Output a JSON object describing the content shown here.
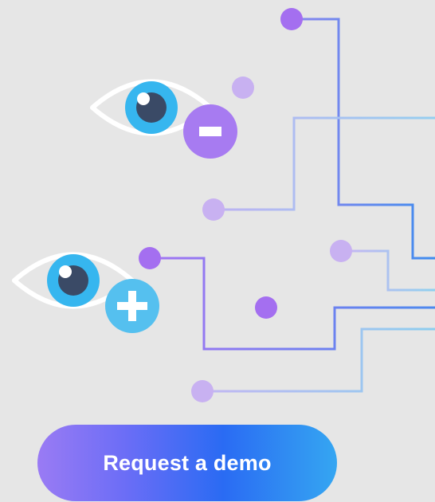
{
  "cta": {
    "label": "Request a demo"
  },
  "illustration": {
    "icons": [
      "eye-icon",
      "minus-badge-icon",
      "eye-icon",
      "plus-badge-icon"
    ],
    "colors": {
      "background": "#e6e6e6",
      "eye_iris": "#36b6ef",
      "eye_pupil": "#3a4a66",
      "eye_outline": "#ffffff",
      "minus_badge": "#a77bf1",
      "plus_badge": "#55c0ef",
      "node_purple": "#a46ff0",
      "node_lilac": "#c8b1f1",
      "line_blue": "#3a88ee",
      "line_sky": "#86ccef",
      "line_teal": "#7fd0dd"
    }
  }
}
